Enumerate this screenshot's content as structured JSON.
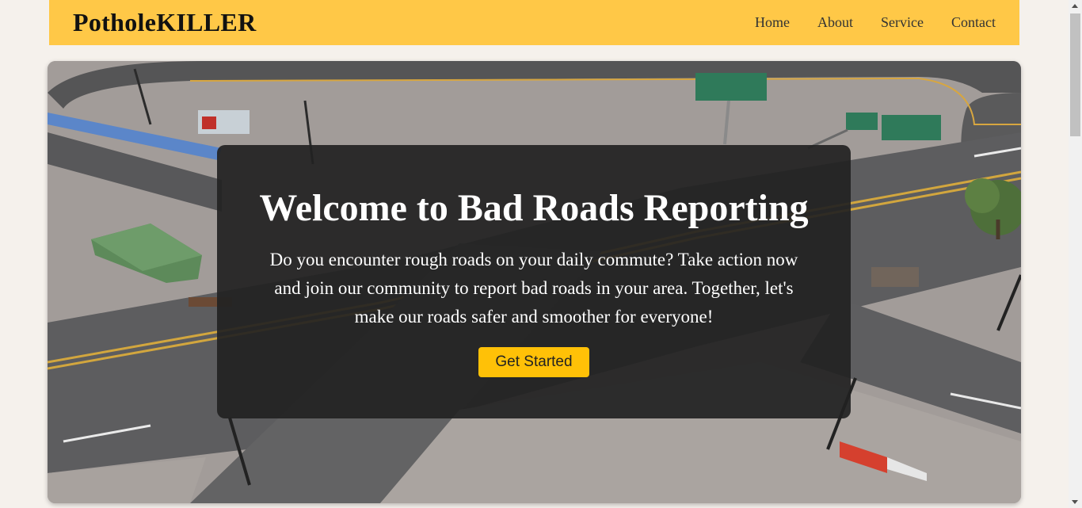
{
  "nav": {
    "brand": "PotholeKILLER",
    "links": [
      "Home",
      "About",
      "Service",
      "Contact"
    ]
  },
  "hero": {
    "title": "Welcome to Bad Roads Reporting",
    "description": "Do you encounter rough roads on your daily commute? Take action now and join our community to report bad roads in your area. Together, let's make our roads safer and smoother for everyone!",
    "cta_label": "Get Started"
  },
  "colors": {
    "navbar_bg": "#ffc847",
    "cta_bg": "#ffc107",
    "overlay_bg": "#222222",
    "page_bg": "#f5f1ec"
  }
}
